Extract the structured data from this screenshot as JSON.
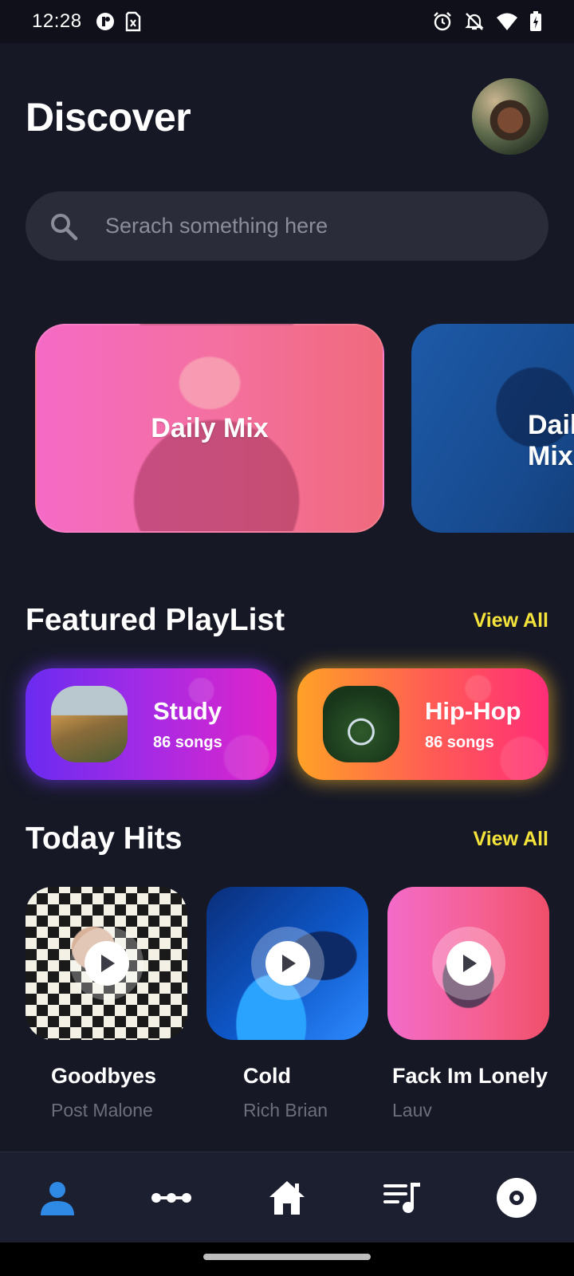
{
  "status_bar": {
    "time": "12:28",
    "left_icons": [
      "app-notification-icon",
      "sim-card-icon"
    ],
    "right_icons": [
      "alarm-icon",
      "notifications-off-icon",
      "wifi-icon",
      "battery-charging-icon"
    ]
  },
  "header": {
    "title": "Discover",
    "avatar": "user-avatar"
  },
  "search": {
    "placeholder": "Serach something here",
    "icon": "search-icon"
  },
  "mixes": [
    {
      "label": "Daily Mix",
      "color": "#f56ac5"
    },
    {
      "label": "Daily Mix",
      "color": "#1d5aa8"
    }
  ],
  "featured": {
    "title": "Featured PlayList",
    "view_all": "View All",
    "playlists": [
      {
        "name": "Study",
        "count": "86 songs",
        "glow": "#7a3cff"
      },
      {
        "name": "Hip-Hop",
        "count": "86 songs",
        "glow": "#ffbe28"
      }
    ]
  },
  "today_hits": {
    "title": "Today Hits",
    "view_all": "View All",
    "items": [
      {
        "title": "Goodbyes",
        "artist": "Post Malone"
      },
      {
        "title": "Cold",
        "artist": "Rich Brian"
      },
      {
        "title": "Fack Im Lonely",
        "artist": "Lauv"
      }
    ]
  },
  "bottom_nav": {
    "items": [
      {
        "icon": "profile-icon",
        "active": true
      },
      {
        "icon": "equalizer-dots-icon",
        "active": false
      },
      {
        "icon": "home-icon",
        "active": false
      },
      {
        "icon": "queue-music-icon",
        "active": false
      },
      {
        "icon": "vinyl-disc-icon",
        "active": false
      }
    ]
  },
  "colors": {
    "background": "#161826",
    "accent": "#f4e33a",
    "active_nav": "#2f8ae6",
    "search_bg": "#2a2c3a"
  }
}
